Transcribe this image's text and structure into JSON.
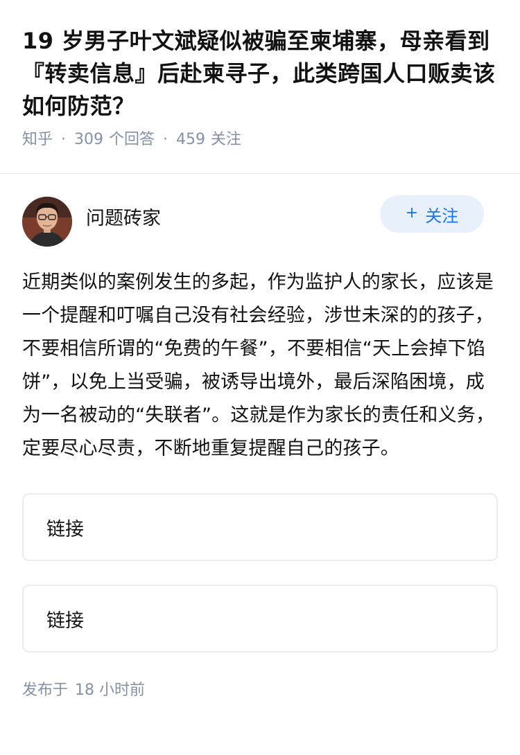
{
  "question": {
    "title": "19 岁男子叶文斌疑似被骗至柬埔寨，母亲看到『转卖信息』后赴柬寻子，此类跨国人口贩卖该如何防范？",
    "source": "知乎",
    "answers_count": "309",
    "answers_label": "个回答",
    "followers_count": "459",
    "followers_label": "关注"
  },
  "answer": {
    "author_name": "问题砖家",
    "follow_label": "关注",
    "follow_icon": "plus-icon",
    "content": "近期类似的案例发生的多起，作为监护人的家长，应该是一个提醒和叮嘱自己没有社会经验，涉世未深的的孩子，不要相信所谓的“免费的午餐”，不要相信“天上会掉下馅饼”，以免上当受骗，被诱导出境外，最后深陷困境，成为一名被动的“失联者”。这就是作为家长的责任和义务，定要尽心尽责，不断地重复提醒自己的孩子。",
    "links": [
      "链接",
      "链接"
    ],
    "publish_prefix": "发布于",
    "publish_time": "18 小时前"
  },
  "colors": {
    "meta_gray": "#8590a6",
    "accent_blue": "#1772f6",
    "follow_bg": "#e8f1fb",
    "border": "#ebebeb"
  }
}
